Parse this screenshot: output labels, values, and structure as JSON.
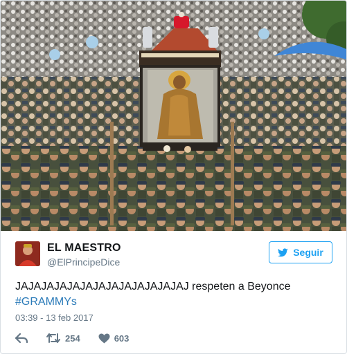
{
  "photo": {
    "icon": "crowd-procession-photo"
  },
  "user": {
    "name": "EL MAESTRO",
    "handle": "@ElPrincipeDice"
  },
  "follow_button": {
    "label": "Seguir",
    "icon": "twitter-bird-icon"
  },
  "tweet": {
    "text": "JAJAJAJAJAJAJAJAJAJAJAJAJAJ respeten a Beyonce",
    "hashtag": "#GRAMMYs",
    "timestamp": "03:39 - 13 feb 2017"
  },
  "actions": {
    "reply": {
      "icon": "reply-icon"
    },
    "retweet": {
      "icon": "retweet-icon",
      "count": "254"
    },
    "like": {
      "icon": "heart-icon",
      "count": "603"
    }
  },
  "colors": {
    "accent": "#1da1f2",
    "hashtag": "#2b7bb9",
    "muted": "#657786",
    "text": "#14171a"
  }
}
